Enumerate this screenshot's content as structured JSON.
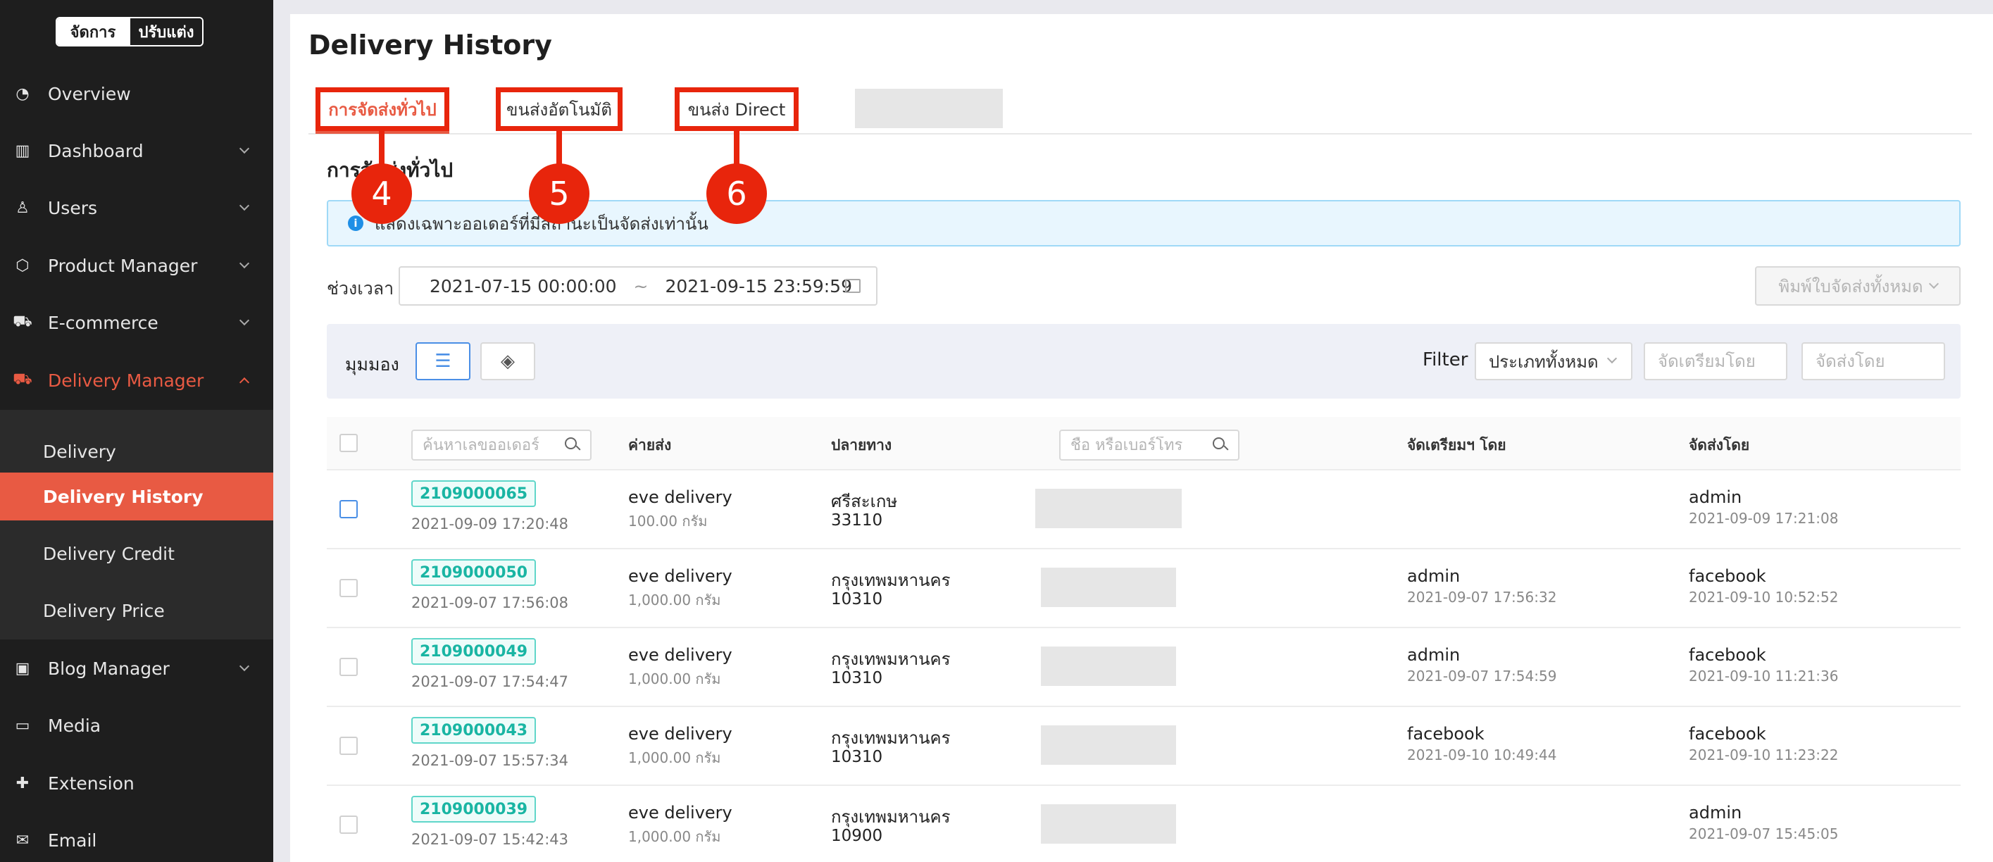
{
  "sidebar": {
    "mode_toggle": [
      "จัดการ",
      "ปรับแต่ง"
    ],
    "items": [
      {
        "label": "Overview",
        "icon": "pie-chart-icon",
        "expandable": false
      },
      {
        "label": "Dashboard",
        "icon": "bar-chart-icon",
        "expandable": true
      },
      {
        "label": "Users",
        "icon": "user-icon",
        "expandable": true
      },
      {
        "label": "Product Manager",
        "icon": "box-icon",
        "expandable": true
      },
      {
        "label": "E-commerce",
        "icon": "cart-icon",
        "expandable": true
      },
      {
        "label": "Delivery Manager",
        "icon": "truck-icon",
        "expandable": true,
        "active": true
      },
      {
        "label": "Blog Manager",
        "icon": "blog-icon",
        "expandable": true
      },
      {
        "label": "Media",
        "icon": "folder-icon",
        "expandable": false
      },
      {
        "label": "Extension",
        "icon": "puzzle-icon",
        "expandable": false
      },
      {
        "label": "Email",
        "icon": "mail-icon",
        "expandable": false
      }
    ],
    "submenu": [
      {
        "label": "Delivery"
      },
      {
        "label": "Delivery History",
        "active": true
      },
      {
        "label": "Delivery Credit"
      },
      {
        "label": "Delivery Price"
      }
    ]
  },
  "page": {
    "title": "Delivery History",
    "tabs": [
      "การจัดส่งทั่วไป",
      "ขนส่งอัตโนมัติ",
      "ขนส่ง Direct"
    ],
    "annotations": [
      "4",
      "5",
      "6"
    ],
    "section_title": "การจัดส่งทั่วไป",
    "info": "แสดงเฉพาะออเดอร์ที่มีสถานะเป็นจัดส่งเท่านั้น",
    "period_label": "ช่วงเวลา",
    "range_start": "2021-07-15 00:00:00",
    "range_sep": "~",
    "range_end": "2021-09-15 23:59:59",
    "print_all": "พิมพ์ใบจัดส่งทั้งหมด"
  },
  "toolbar": {
    "view_label": "มุมมอง",
    "filter_label": "Filter",
    "type_select": "ประเภททั้งหมด",
    "prepared_by_placeholder": "จัดเตรียมโดย",
    "shipped_by_placeholder": "จัดส่งโดย"
  },
  "table": {
    "order_search_placeholder": "ค้นหาเลขออเดอร์",
    "headers": {
      "shipping": "ค่ายส่ง",
      "destination": "ปลายทาง",
      "prepared_by": "จัดเตรียมฯ โดย",
      "shipped_by": "จัดส่งโดย"
    },
    "name_search_placeholder": "ชื่อ หรือเบอร์โทร",
    "rows": [
      {
        "order": "2109000065",
        "date": "2021-09-09 17:20:48",
        "carrier": "eve delivery",
        "weight": "100.00 กรัม",
        "province": "ศรีสะเกษ",
        "postcode": "33110",
        "prepared_by": "",
        "prepared_at": "",
        "shipped_by": "admin",
        "shipped_at": "2021-09-09 17:21:08"
      },
      {
        "order": "2109000050",
        "date": "2021-09-07 17:56:08",
        "carrier": "eve delivery",
        "weight": "1,000.00 กรัม",
        "province": "กรุงเทพมหานคร",
        "postcode": "10310",
        "prepared_by": "admin",
        "prepared_at": "2021-09-07 17:56:32",
        "shipped_by": "facebook",
        "shipped_at": "2021-09-10 10:52:52"
      },
      {
        "order": "2109000049",
        "date": "2021-09-07 17:54:47",
        "carrier": "eve delivery",
        "weight": "1,000.00 กรัม",
        "province": "กรุงเทพมหานคร",
        "postcode": "10310",
        "prepared_by": "admin",
        "prepared_at": "2021-09-07 17:54:59",
        "shipped_by": "facebook",
        "shipped_at": "2021-09-10 11:21:36"
      },
      {
        "order": "2109000043",
        "date": "2021-09-07 15:57:34",
        "carrier": "eve delivery",
        "weight": "1,000.00 กรัม",
        "province": "กรุงเทพมหานคร",
        "postcode": "10310",
        "prepared_by": "facebook",
        "prepared_at": "2021-09-10 10:49:44",
        "shipped_by": "facebook",
        "shipped_at": "2021-09-10 11:23:22"
      },
      {
        "order": "2109000039",
        "date": "2021-09-07 15:42:43",
        "carrier": "eve delivery",
        "weight": "1,000.00 กรัม",
        "province": "กรุงเทพมหานคร",
        "postcode": "10900",
        "prepared_by": "",
        "prepared_at": "",
        "shipped_by": "admin",
        "shipped_at": "2021-09-07 15:45:05"
      }
    ]
  },
  "colors": {
    "accent": "#e85a43",
    "annotation": "#e8250c",
    "order_tag": "#19b5a3",
    "info_border": "#9fd9f7",
    "sidebar_bg": "#1e1e1e"
  }
}
